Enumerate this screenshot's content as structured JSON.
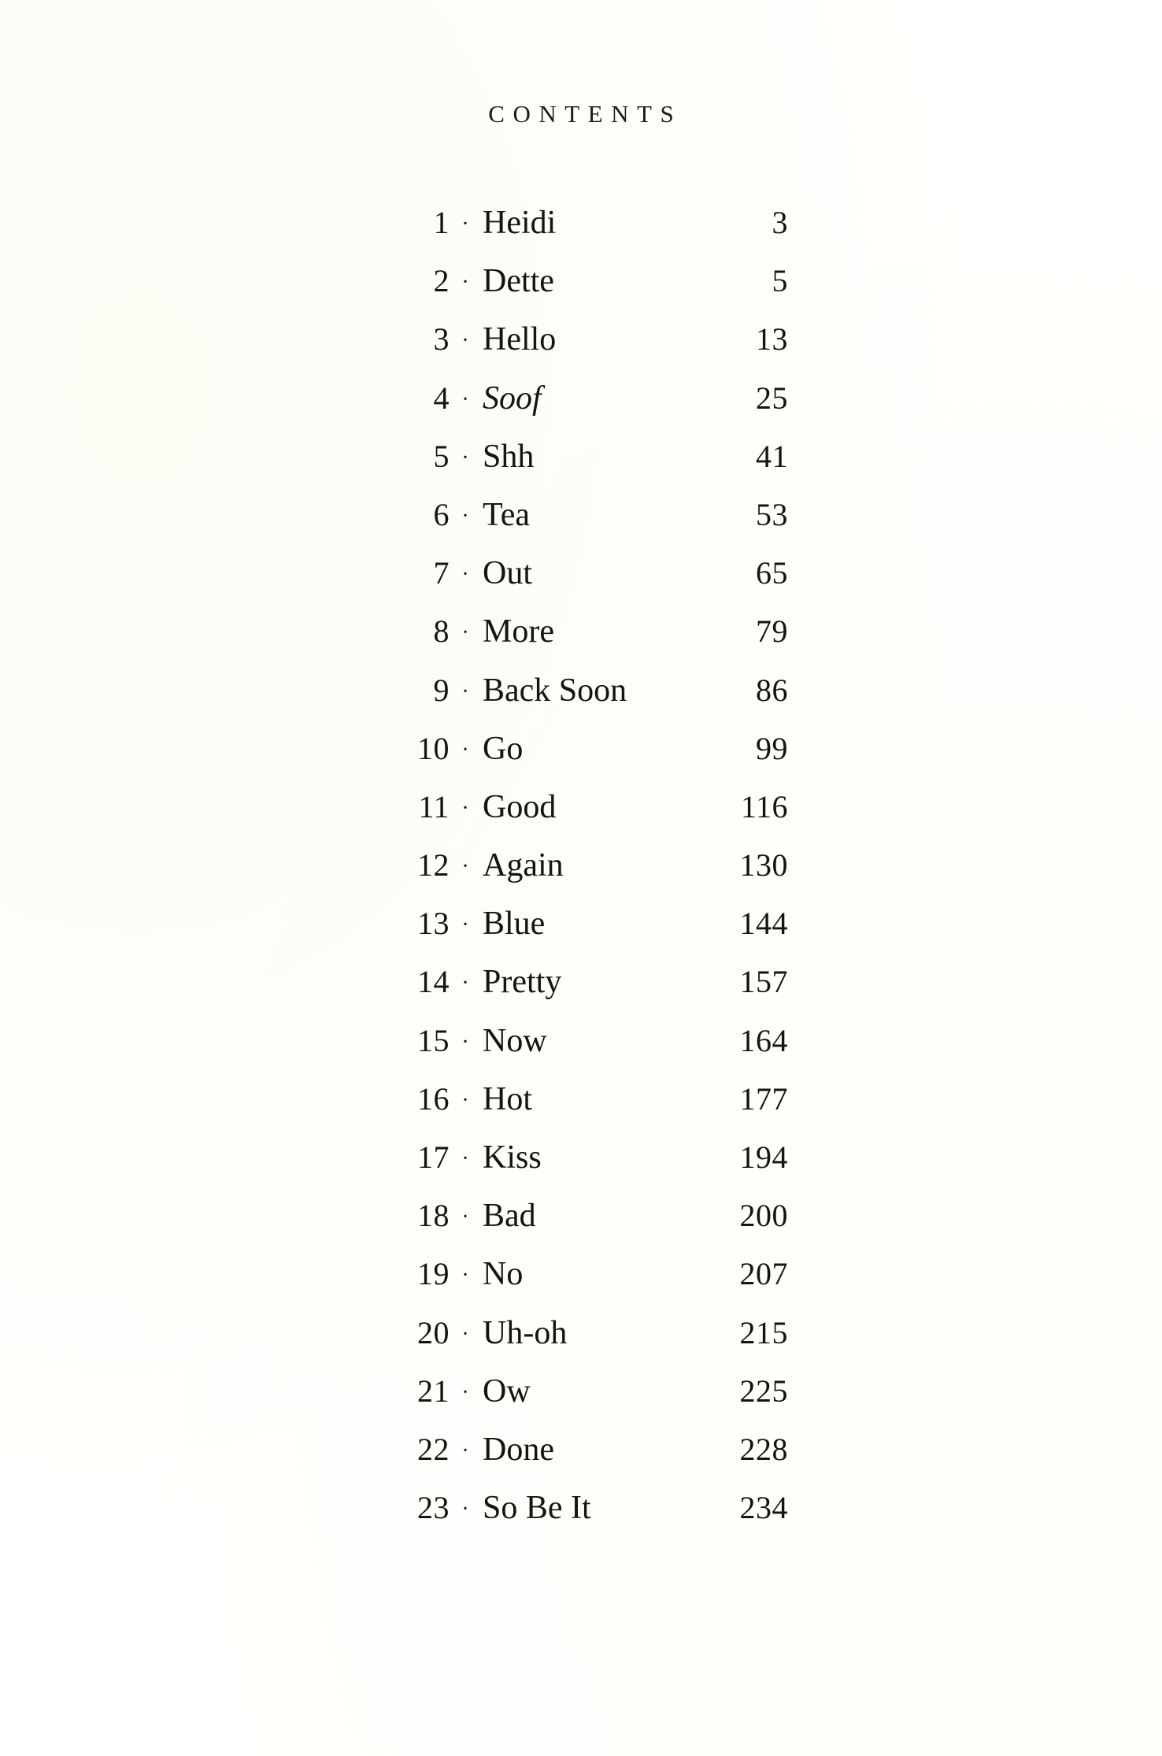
{
  "document": {
    "heading": "CONTENTS",
    "separator": "·",
    "paper_color": "#fffffd",
    "ink_color": "#15150f"
  },
  "toc": {
    "entries": [
      {
        "number": "1",
        "title": "Heidi",
        "page": "3",
        "style": "roman"
      },
      {
        "number": "2",
        "title": "Dette",
        "page": "5",
        "style": "roman"
      },
      {
        "number": "3",
        "title": "Hello",
        "page": "13",
        "style": "roman"
      },
      {
        "number": "4",
        "title": "Soof",
        "page": "25",
        "style": "italic"
      },
      {
        "number": "5",
        "title": "Shh",
        "page": "41",
        "style": "roman"
      },
      {
        "number": "6",
        "title": "Tea",
        "page": "53",
        "style": "roman"
      },
      {
        "number": "7",
        "title": "Out",
        "page": "65",
        "style": "roman"
      },
      {
        "number": "8",
        "title": "More",
        "page": "79",
        "style": "roman"
      },
      {
        "number": "9",
        "title": "Back Soon",
        "page": "86",
        "style": "roman"
      },
      {
        "number": "10",
        "title": "Go",
        "page": "99",
        "style": "roman"
      },
      {
        "number": "11",
        "title": "Good",
        "page": "116",
        "style": "roman"
      },
      {
        "number": "12",
        "title": "Again",
        "page": "130",
        "style": "roman"
      },
      {
        "number": "13",
        "title": "Blue",
        "page": "144",
        "style": "roman"
      },
      {
        "number": "14",
        "title": "Pretty",
        "page": "157",
        "style": "roman"
      },
      {
        "number": "15",
        "title": "Now",
        "page": "164",
        "style": "roman"
      },
      {
        "number": "16",
        "title": "Hot",
        "page": "177",
        "style": "roman"
      },
      {
        "number": "17",
        "title": "Kiss",
        "page": "194",
        "style": "roman"
      },
      {
        "number": "18",
        "title": "Bad",
        "page": "200",
        "style": "roman"
      },
      {
        "number": "19",
        "title": "No",
        "page": "207",
        "style": "roman"
      },
      {
        "number": "20",
        "title": "Uh-oh",
        "page": "215",
        "style": "roman"
      },
      {
        "number": "21",
        "title": "Ow",
        "page": "225",
        "style": "roman"
      },
      {
        "number": "22",
        "title": "Done",
        "page": "228",
        "style": "roman"
      },
      {
        "number": "23",
        "title": "So Be It",
        "page": "234",
        "style": "roman"
      }
    ]
  }
}
